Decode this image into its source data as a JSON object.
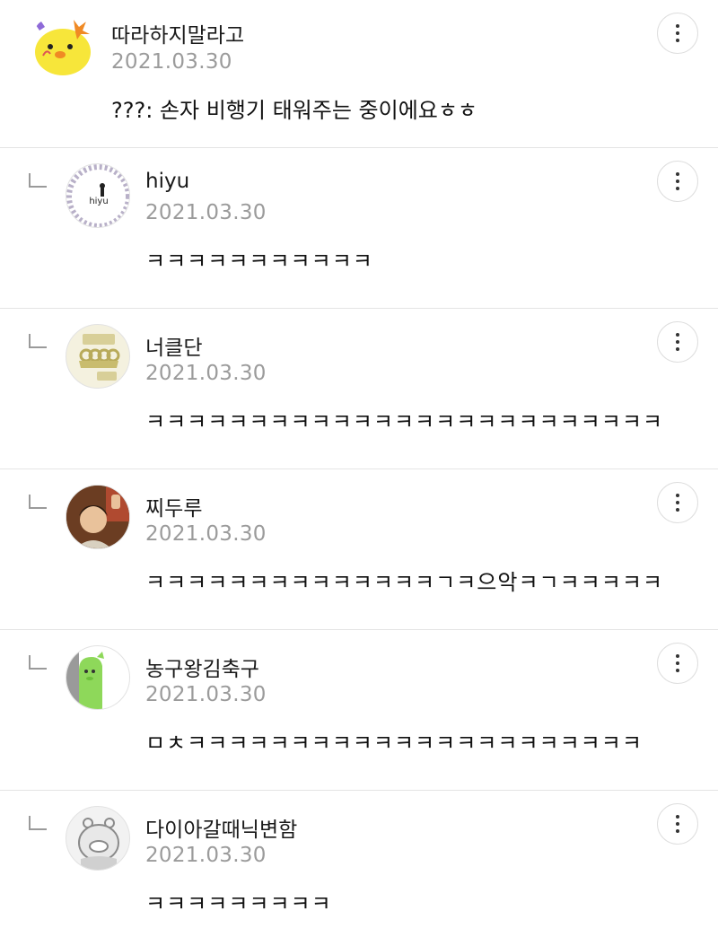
{
  "comments": [
    {
      "nickname": "따라하지말라고",
      "date": "2021.03.30",
      "text": "???: 손자 비행기 태워주는 중이에요ㅎㅎ",
      "avatar_icon": "yellow-chick-avatar-icon"
    },
    {
      "nickname": "hiyu",
      "date": "2021.03.30",
      "text": "ㅋㅋㅋㅋㅋㅋㅋㅋㅋㅋㅋ",
      "avatar_icon": "hiyu-logo-avatar-icon",
      "avatar_text": "hiyu"
    },
    {
      "nickname": "너클단",
      "date": "2021.03.30",
      "text": "ㅋㅋㅋㅋㅋㅋㅋㅋㅋㅋㅋㅋㅋㅋㅋㅋㅋㅋㅋㅋㅋㅋㅋㅋㅋ",
      "avatar_icon": "brass-knuckles-avatar-icon"
    },
    {
      "nickname": "찌두루",
      "date": "2021.03.30",
      "text": "ㅋㅋㅋㅋㅋㅋㅋㅋㅋㅋㅋㅋㅋㅋㄱㅋ으악ㅋㄱㅋㅋㅋㅋㅋ",
      "avatar_icon": "person-photo-avatar-icon"
    },
    {
      "nickname": "농구왕김축구",
      "date": "2021.03.30",
      "text": "ㅁㅊㅋㅋㅋㅋㅋㅋㅋㅋㅋㅋㅋㅋㅋㅋㅋㅋㅋㅋㅋㅋㅋㅋ",
      "avatar_icon": "green-character-avatar-icon"
    },
    {
      "nickname": "다이아갈때닉변함",
      "date": "2021.03.30",
      "text": "ㅋㅋㅋㅋㅋㅋㅋㅋㅋ",
      "avatar_icon": "gray-character-avatar-icon"
    }
  ],
  "more_icon": "more-vertical-icon",
  "reply_icon": "reply-arrow-icon"
}
